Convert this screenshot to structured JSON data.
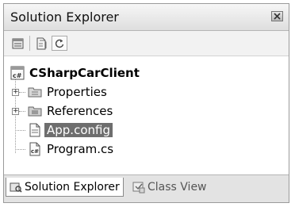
{
  "window": {
    "title": "Solution Explorer",
    "close_icon": "close-icon"
  },
  "toolbar": {
    "buttons": [
      "properties-icon",
      "show-all-files-icon",
      "refresh-icon"
    ]
  },
  "tree": {
    "root": {
      "label": "CSharpCarClient",
      "icon": "csharp-project-icon"
    },
    "items": [
      {
        "label": "Properties",
        "icon": "properties-folder-icon",
        "expandable": true
      },
      {
        "label": "References",
        "icon": "references-folder-icon",
        "expandable": true
      },
      {
        "label": "App.config",
        "icon": "config-file-icon",
        "selected": true
      },
      {
        "label": "Program.cs",
        "icon": "csharp-file-icon"
      }
    ]
  },
  "tabs": [
    {
      "label": "Solution Explorer",
      "icon": "solution-explorer-icon",
      "active": true
    },
    {
      "label": "Class View",
      "icon": "class-view-icon",
      "active": false
    }
  ],
  "colors": {
    "selection": "#6e6e6e",
    "panel_border": "#9a9a9a"
  }
}
